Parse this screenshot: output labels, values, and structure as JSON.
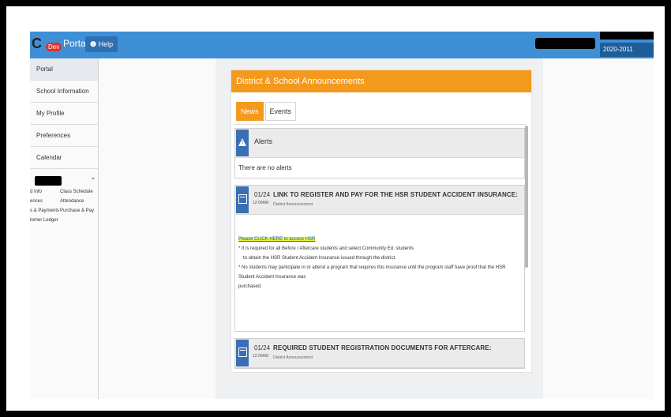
{
  "header": {
    "logo_text": "C",
    "logo_badge": "Dev",
    "app_title": "Portal",
    "help_label": "Help",
    "school_year": "2020-2011"
  },
  "sidebar": {
    "items": [
      {
        "label": "Portal"
      },
      {
        "label": "School Information"
      },
      {
        "label": "My Profile"
      },
      {
        "label": "Preferences"
      },
      {
        "label": "Calendar"
      }
    ],
    "student_links": {
      "col1": [
        "d Info",
        "ences",
        "s & Payments",
        "tomer Ledger"
      ],
      "col2": [
        "Class Schedule",
        "Attendance",
        "Purchase & Pay"
      ]
    }
  },
  "announcements": {
    "panel_title": "District & School Announcements",
    "tabs": [
      {
        "label": "News"
      },
      {
        "label": "Events"
      }
    ],
    "alerts": {
      "title": "Alerts",
      "body": "There are no alerts"
    },
    "items": [
      {
        "date": "01/24",
        "time": "12:00AM",
        "title": "LINK TO REGISTER AND PAY FOR THE HSR STUDENT ACCIDENT INSURANCE:",
        "source": "District Announcement",
        "link_text": "Please CLICK HERE to access HSR",
        "bullet1_line1": "* It is required for all Before / Aftercare students and select Community Ed. students",
        "bullet1_line2": "to obtain the HSR Student Accident Insurance issued through the district.",
        "bullet2_line1": "* No students may participate in or attend a program that requires this insurance until the program staff have proof that the HSR Student Accident Insurance was",
        "bullet2_line2": "purchased."
      },
      {
        "date": "01/24",
        "time": "12:00AM",
        "title": "REQUIRED STUDENT REGISTRATION DOCUMENTS FOR AFTERCARE:",
        "source": "District Announcement"
      }
    ]
  },
  "colors": {
    "topbar": "#3f8fd6",
    "orange_accent": "#f39a1e",
    "icon_blue": "#3a6fb3",
    "highlight": "#e8f63a"
  }
}
